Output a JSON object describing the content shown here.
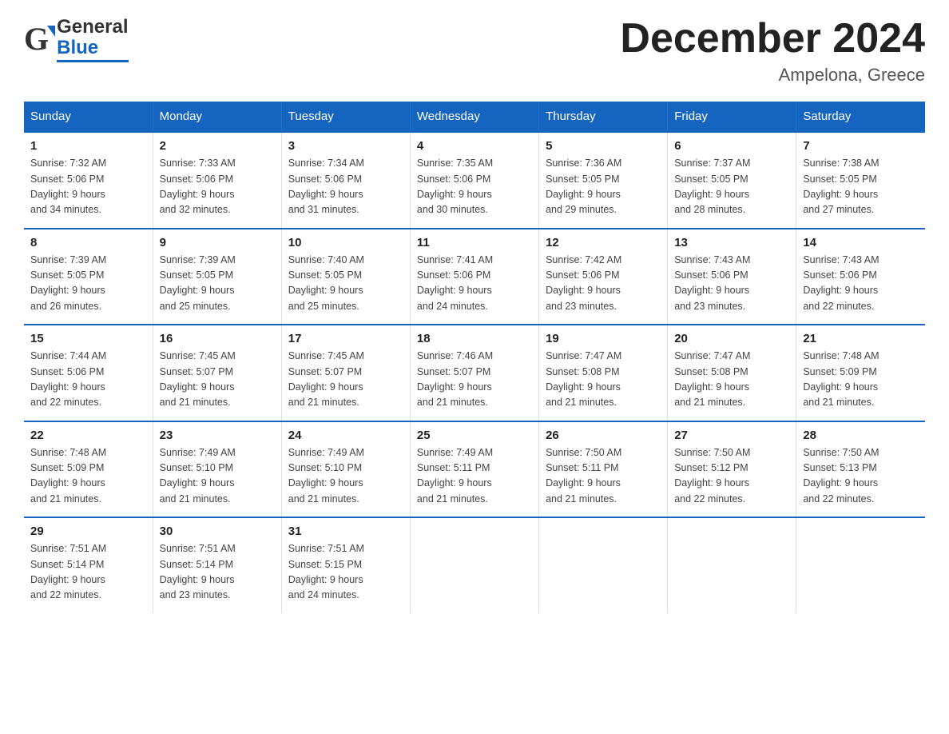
{
  "logo": {
    "general": "General",
    "blue": "Blue"
  },
  "header": {
    "title": "December 2024",
    "subtitle": "Ampelona, Greece"
  },
  "columns": [
    "Sunday",
    "Monday",
    "Tuesday",
    "Wednesday",
    "Thursday",
    "Friday",
    "Saturday"
  ],
  "weeks": [
    [
      {
        "day": "1",
        "sunrise": "7:32 AM",
        "sunset": "5:06 PM",
        "daylight": "9 hours and 34 minutes."
      },
      {
        "day": "2",
        "sunrise": "7:33 AM",
        "sunset": "5:06 PM",
        "daylight": "9 hours and 32 minutes."
      },
      {
        "day": "3",
        "sunrise": "7:34 AM",
        "sunset": "5:06 PM",
        "daylight": "9 hours and 31 minutes."
      },
      {
        "day": "4",
        "sunrise": "7:35 AM",
        "sunset": "5:06 PM",
        "daylight": "9 hours and 30 minutes."
      },
      {
        "day": "5",
        "sunrise": "7:36 AM",
        "sunset": "5:05 PM",
        "daylight": "9 hours and 29 minutes."
      },
      {
        "day": "6",
        "sunrise": "7:37 AM",
        "sunset": "5:05 PM",
        "daylight": "9 hours and 28 minutes."
      },
      {
        "day": "7",
        "sunrise": "7:38 AM",
        "sunset": "5:05 PM",
        "daylight": "9 hours and 27 minutes."
      }
    ],
    [
      {
        "day": "8",
        "sunrise": "7:39 AM",
        "sunset": "5:05 PM",
        "daylight": "9 hours and 26 minutes."
      },
      {
        "day": "9",
        "sunrise": "7:39 AM",
        "sunset": "5:05 PM",
        "daylight": "9 hours and 25 minutes."
      },
      {
        "day": "10",
        "sunrise": "7:40 AM",
        "sunset": "5:05 PM",
        "daylight": "9 hours and 25 minutes."
      },
      {
        "day": "11",
        "sunrise": "7:41 AM",
        "sunset": "5:06 PM",
        "daylight": "9 hours and 24 minutes."
      },
      {
        "day": "12",
        "sunrise": "7:42 AM",
        "sunset": "5:06 PM",
        "daylight": "9 hours and 23 minutes."
      },
      {
        "day": "13",
        "sunrise": "7:43 AM",
        "sunset": "5:06 PM",
        "daylight": "9 hours and 23 minutes."
      },
      {
        "day": "14",
        "sunrise": "7:43 AM",
        "sunset": "5:06 PM",
        "daylight": "9 hours and 22 minutes."
      }
    ],
    [
      {
        "day": "15",
        "sunrise": "7:44 AM",
        "sunset": "5:06 PM",
        "daylight": "9 hours and 22 minutes."
      },
      {
        "day": "16",
        "sunrise": "7:45 AM",
        "sunset": "5:07 PM",
        "daylight": "9 hours and 21 minutes."
      },
      {
        "day": "17",
        "sunrise": "7:45 AM",
        "sunset": "5:07 PM",
        "daylight": "9 hours and 21 minutes."
      },
      {
        "day": "18",
        "sunrise": "7:46 AM",
        "sunset": "5:07 PM",
        "daylight": "9 hours and 21 minutes."
      },
      {
        "day": "19",
        "sunrise": "7:47 AM",
        "sunset": "5:08 PM",
        "daylight": "9 hours and 21 minutes."
      },
      {
        "day": "20",
        "sunrise": "7:47 AM",
        "sunset": "5:08 PM",
        "daylight": "9 hours and 21 minutes."
      },
      {
        "day": "21",
        "sunrise": "7:48 AM",
        "sunset": "5:09 PM",
        "daylight": "9 hours and 21 minutes."
      }
    ],
    [
      {
        "day": "22",
        "sunrise": "7:48 AM",
        "sunset": "5:09 PM",
        "daylight": "9 hours and 21 minutes."
      },
      {
        "day": "23",
        "sunrise": "7:49 AM",
        "sunset": "5:10 PM",
        "daylight": "9 hours and 21 minutes."
      },
      {
        "day": "24",
        "sunrise": "7:49 AM",
        "sunset": "5:10 PM",
        "daylight": "9 hours and 21 minutes."
      },
      {
        "day": "25",
        "sunrise": "7:49 AM",
        "sunset": "5:11 PM",
        "daylight": "9 hours and 21 minutes."
      },
      {
        "day": "26",
        "sunrise": "7:50 AM",
        "sunset": "5:11 PM",
        "daylight": "9 hours and 21 minutes."
      },
      {
        "day": "27",
        "sunrise": "7:50 AM",
        "sunset": "5:12 PM",
        "daylight": "9 hours and 22 minutes."
      },
      {
        "day": "28",
        "sunrise": "7:50 AM",
        "sunset": "5:13 PM",
        "daylight": "9 hours and 22 minutes."
      }
    ],
    [
      {
        "day": "29",
        "sunrise": "7:51 AM",
        "sunset": "5:14 PM",
        "daylight": "9 hours and 22 minutes."
      },
      {
        "day": "30",
        "sunrise": "7:51 AM",
        "sunset": "5:14 PM",
        "daylight": "9 hours and 23 minutes."
      },
      {
        "day": "31",
        "sunrise": "7:51 AM",
        "sunset": "5:15 PM",
        "daylight": "9 hours and 24 minutes."
      },
      null,
      null,
      null,
      null
    ]
  ],
  "labels": {
    "sunrise": "Sunrise:",
    "sunset": "Sunset:",
    "daylight": "Daylight:"
  }
}
